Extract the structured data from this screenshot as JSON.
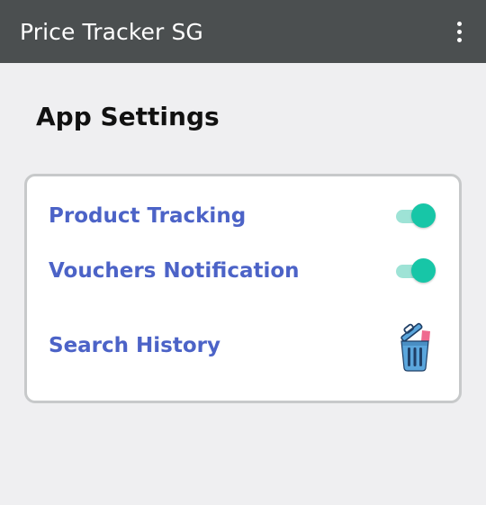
{
  "app_bar": {
    "title": "Price Tracker SG",
    "menu_icon": "more-vert-icon"
  },
  "settings": {
    "heading": "App Settings",
    "items": [
      {
        "label": "Product Tracking",
        "control": "toggle",
        "enabled": true
      },
      {
        "label": "Vouchers Notification",
        "control": "toggle",
        "enabled": true
      },
      {
        "label": "Search History",
        "control": "clear-button",
        "icon": "trash-bin-icon"
      }
    ]
  },
  "colors": {
    "app_bar": "#4b4f50",
    "background": "#efeff1",
    "label": "#4c63c7",
    "toggle_on": "#17c6a7",
    "toggle_track": "#9ee3d6"
  }
}
